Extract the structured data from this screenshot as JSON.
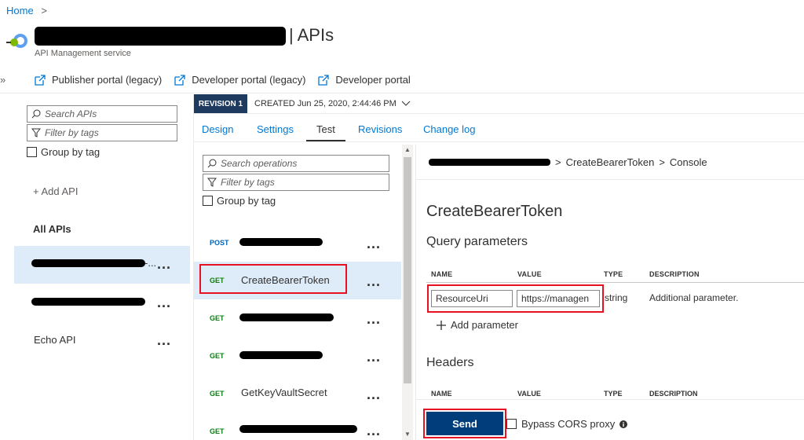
{
  "breadcrumb": {
    "home": "Home",
    "separator": ">"
  },
  "header": {
    "title_suffix": "| APIs",
    "subtitle": "API Management service"
  },
  "portal_links": [
    {
      "label": "Publisher portal (legacy)"
    },
    {
      "label": "Developer portal (legacy)"
    },
    {
      "label": "Developer portal"
    }
  ],
  "apis_panel": {
    "search_placeholder": "Search APIs",
    "filter_placeholder": "Filter by tags",
    "group_label": "Group by tag",
    "add_api": "+ Add API",
    "section_title": "All APIs",
    "items": [
      {
        "label": "-..."
      },
      {
        "label": ""
      },
      {
        "label": "Echo API"
      }
    ]
  },
  "revision": {
    "badge": "REVISION 1",
    "created": "CREATED Jun 25, 2020, 2:44:46 PM"
  },
  "tabs": [
    {
      "label": "Design"
    },
    {
      "label": "Settings"
    },
    {
      "label": "Test"
    },
    {
      "label": "Revisions"
    },
    {
      "label": "Change log"
    }
  ],
  "operations_panel": {
    "search_placeholder": "Search operations",
    "filter_placeholder": "Filter by tags",
    "group_label": "Group by tag",
    "items": [
      {
        "method": "POST",
        "name": ""
      },
      {
        "method": "GET",
        "name": "CreateBearerToken"
      },
      {
        "method": "GET",
        "name": ""
      },
      {
        "method": "GET",
        "name": ""
      },
      {
        "method": "GET",
        "name": "GetKeyVaultSecret"
      },
      {
        "method": "GET",
        "name": ""
      }
    ]
  },
  "console": {
    "breadcrumb_op": "CreateBearerToken",
    "breadcrumb_sep": ">",
    "breadcrumb_end": "Console",
    "title": "CreateBearerToken",
    "query_heading": "Query parameters",
    "columns": [
      "NAME",
      "VALUE",
      "TYPE",
      "DESCRIPTION"
    ],
    "param": {
      "name": "ResourceUri",
      "value": "https://managen",
      "type": "string",
      "description": "Additional parameter."
    },
    "add_parameter": "Add parameter",
    "headers_heading": "Headers",
    "send_label": "Send",
    "bypass_label": "Bypass CORS proxy"
  },
  "colors": {
    "accent": "#0078d4",
    "highlight_red": "#e81123",
    "send_bg": "#003d7a",
    "revision_bg": "#1e3a5f"
  }
}
